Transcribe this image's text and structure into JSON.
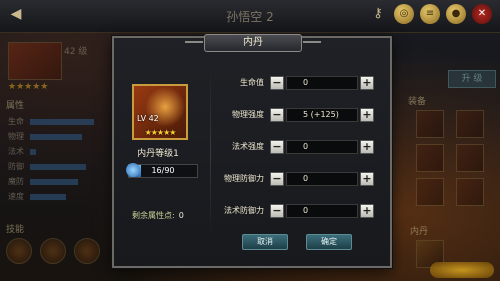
{
  "topbar": {
    "title": "孙悟空 2"
  },
  "left": {
    "level_label": "42 级",
    "attr_title": "属性",
    "attrs": [
      {
        "name": "生命",
        "level": 0.8
      },
      {
        "name": "物理",
        "level": 0.65
      },
      {
        "name": "法术",
        "level": 0.08
      },
      {
        "name": "防御",
        "level": 0.7
      },
      {
        "name": "魔防",
        "level": 0.6
      },
      {
        "name": "速度",
        "level": 0.45
      }
    ],
    "skill_title": "技能"
  },
  "right": {
    "upgrade_label": "升 级",
    "equip_title": "装备",
    "pill_title": "内丹"
  },
  "modal": {
    "title": "内丹",
    "hero": {
      "level_text": "LV 42",
      "stars": "★★★★★",
      "stars_count": 5
    },
    "level_label": "内丹等级1",
    "progress": {
      "text": "16/90",
      "current": 16,
      "max": 90
    },
    "remain_label": "剩余属性点:",
    "remain_value": "0",
    "stats": [
      {
        "label": "生命值",
        "value": "0"
      },
      {
        "label": "物理强度",
        "value": "5 (+125)"
      },
      {
        "label": "法术强度",
        "value": "0"
      },
      {
        "label": "物理防御力",
        "value": "0"
      },
      {
        "label": "法术防御力",
        "value": "0"
      }
    ],
    "minus_glyph": "−",
    "plus_glyph": "+",
    "cancel_label": "取消",
    "confirm_label": "确定"
  },
  "colors": {
    "accent": "#c89b3c",
    "button": "#3b6e7a",
    "progress": "#2a6cae"
  }
}
